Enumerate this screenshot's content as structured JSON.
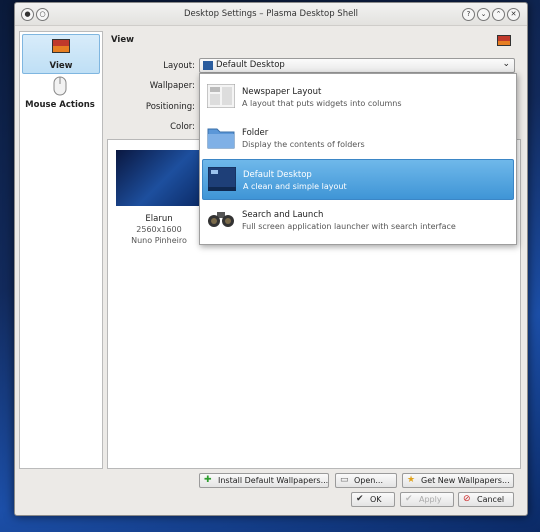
{
  "window": {
    "title": "Desktop Settings – Plasma Desktop Shell"
  },
  "sidebar": {
    "items": [
      {
        "label": "View"
      },
      {
        "label": "Mouse Actions"
      }
    ]
  },
  "view": {
    "heading": "View",
    "labels": {
      "layout": "Layout:",
      "wallpaper": "Wallpaper:",
      "positioning": "Positioning:",
      "color": "Color:"
    },
    "layout_value": "Default Desktop"
  },
  "layout_options": [
    {
      "title": "Newspaper Layout",
      "desc": "A layout that puts widgets into columns"
    },
    {
      "title": "Folder",
      "desc": "Display the contents of folders"
    },
    {
      "title": "Default Desktop",
      "desc": "A clean and simple layout"
    },
    {
      "title": "Search and Launch",
      "desc": "Full screen application launcher with search interface"
    }
  ],
  "wallpaper": {
    "name": "Elarun",
    "size": "2560x1600",
    "author": "Nuno Pinheiro"
  },
  "buttons": {
    "install": "Install Default Wallpapers...",
    "open": "Open...",
    "get_new": "Get New Wallpapers...",
    "ok": "OK",
    "apply": "Apply",
    "cancel": "Cancel"
  },
  "colors": {
    "selection": "#3f95d6",
    "desktop_bg": "#1c4fa8"
  }
}
